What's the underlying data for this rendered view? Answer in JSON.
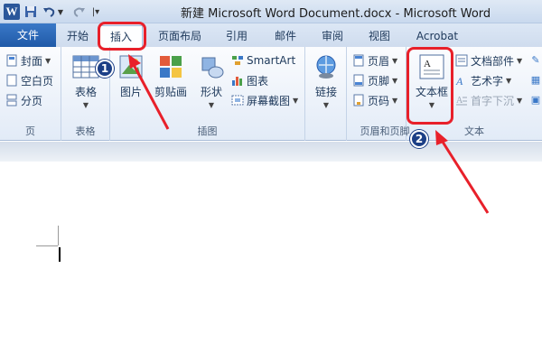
{
  "titlebar": {
    "title": "新建 Microsoft Word Document.docx  -  Microsoft Word",
    "word_icon": "W",
    "icons": [
      "word-app-icon",
      "save-icon",
      "undo-icon",
      "redo-icon",
      "customize-quick-access-icon"
    ]
  },
  "tabs": {
    "file": "文件",
    "home": "开始",
    "insert": "插入",
    "page_layout": "页面布局",
    "references": "引用",
    "mailings": "邮件",
    "review": "审阅",
    "view": "视图",
    "acrobat": "Acrobat"
  },
  "ribbon": {
    "pages": {
      "label": "页",
      "cover": "封面",
      "blank": "空白页",
      "break": "分页"
    },
    "tables": {
      "label": "表格",
      "table": "表格"
    },
    "illustrations": {
      "label": "插图",
      "picture": "图片",
      "clipart": "剪贴画",
      "shapes": "形状",
      "smartart": "SmartArt",
      "chart": "图表",
      "screenshot": "屏幕截图"
    },
    "links": {
      "link": "链接"
    },
    "header_footer": {
      "label": "页眉和页脚",
      "header": "页眉",
      "footer": "页脚",
      "page_number": "页码"
    },
    "text": {
      "label": "文本",
      "textbox": "文本框",
      "quickparts": "文档部件",
      "wordart": "艺术字",
      "dropcap": "首字下沉"
    }
  },
  "annotations": {
    "step1": "1",
    "step2": "2",
    "highlight_color": "#e8202a",
    "badge_color": "#1c3f86"
  },
  "colors": {
    "file_tab": "#2b5fae",
    "ribbon_text": "#1e395b"
  }
}
